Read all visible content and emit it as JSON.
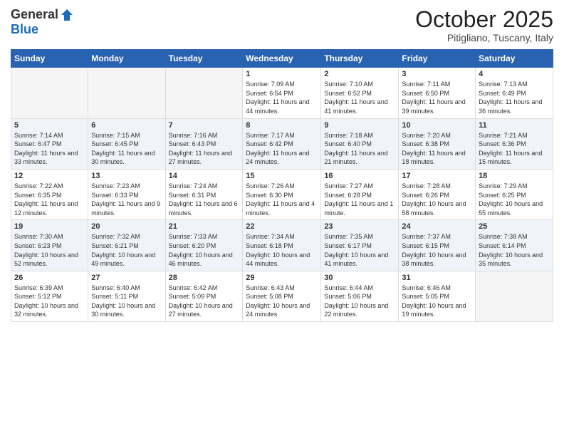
{
  "logo": {
    "general": "General",
    "blue": "Blue"
  },
  "title": "October 2025",
  "location": "Pitigliano, Tuscany, Italy",
  "days_of_week": [
    "Sunday",
    "Monday",
    "Tuesday",
    "Wednesday",
    "Thursday",
    "Friday",
    "Saturday"
  ],
  "weeks": [
    [
      {
        "day": "",
        "info": ""
      },
      {
        "day": "",
        "info": ""
      },
      {
        "day": "",
        "info": ""
      },
      {
        "day": "1",
        "info": "Sunrise: 7:09 AM\nSunset: 6:54 PM\nDaylight: 11 hours and 44 minutes."
      },
      {
        "day": "2",
        "info": "Sunrise: 7:10 AM\nSunset: 6:52 PM\nDaylight: 11 hours and 41 minutes."
      },
      {
        "day": "3",
        "info": "Sunrise: 7:11 AM\nSunset: 6:50 PM\nDaylight: 11 hours and 39 minutes."
      },
      {
        "day": "4",
        "info": "Sunrise: 7:13 AM\nSunset: 6:49 PM\nDaylight: 11 hours and 36 minutes."
      }
    ],
    [
      {
        "day": "5",
        "info": "Sunrise: 7:14 AM\nSunset: 6:47 PM\nDaylight: 11 hours and 33 minutes."
      },
      {
        "day": "6",
        "info": "Sunrise: 7:15 AM\nSunset: 6:45 PM\nDaylight: 11 hours and 30 minutes."
      },
      {
        "day": "7",
        "info": "Sunrise: 7:16 AM\nSunset: 6:43 PM\nDaylight: 11 hours and 27 minutes."
      },
      {
        "day": "8",
        "info": "Sunrise: 7:17 AM\nSunset: 6:42 PM\nDaylight: 11 hours and 24 minutes."
      },
      {
        "day": "9",
        "info": "Sunrise: 7:18 AM\nSunset: 6:40 PM\nDaylight: 11 hours and 21 minutes."
      },
      {
        "day": "10",
        "info": "Sunrise: 7:20 AM\nSunset: 6:38 PM\nDaylight: 11 hours and 18 minutes."
      },
      {
        "day": "11",
        "info": "Sunrise: 7:21 AM\nSunset: 6:36 PM\nDaylight: 11 hours and 15 minutes."
      }
    ],
    [
      {
        "day": "12",
        "info": "Sunrise: 7:22 AM\nSunset: 6:35 PM\nDaylight: 11 hours and 12 minutes."
      },
      {
        "day": "13",
        "info": "Sunrise: 7:23 AM\nSunset: 6:33 PM\nDaylight: 11 hours and 9 minutes."
      },
      {
        "day": "14",
        "info": "Sunrise: 7:24 AM\nSunset: 6:31 PM\nDaylight: 11 hours and 6 minutes."
      },
      {
        "day": "15",
        "info": "Sunrise: 7:26 AM\nSunset: 6:30 PM\nDaylight: 11 hours and 4 minutes."
      },
      {
        "day": "16",
        "info": "Sunrise: 7:27 AM\nSunset: 6:28 PM\nDaylight: 11 hours and 1 minute."
      },
      {
        "day": "17",
        "info": "Sunrise: 7:28 AM\nSunset: 6:26 PM\nDaylight: 10 hours and 58 minutes."
      },
      {
        "day": "18",
        "info": "Sunrise: 7:29 AM\nSunset: 6:25 PM\nDaylight: 10 hours and 55 minutes."
      }
    ],
    [
      {
        "day": "19",
        "info": "Sunrise: 7:30 AM\nSunset: 6:23 PM\nDaylight: 10 hours and 52 minutes."
      },
      {
        "day": "20",
        "info": "Sunrise: 7:32 AM\nSunset: 6:21 PM\nDaylight: 10 hours and 49 minutes."
      },
      {
        "day": "21",
        "info": "Sunrise: 7:33 AM\nSunset: 6:20 PM\nDaylight: 10 hours and 46 minutes."
      },
      {
        "day": "22",
        "info": "Sunrise: 7:34 AM\nSunset: 6:18 PM\nDaylight: 10 hours and 44 minutes."
      },
      {
        "day": "23",
        "info": "Sunrise: 7:35 AM\nSunset: 6:17 PM\nDaylight: 10 hours and 41 minutes."
      },
      {
        "day": "24",
        "info": "Sunrise: 7:37 AM\nSunset: 6:15 PM\nDaylight: 10 hours and 38 minutes."
      },
      {
        "day": "25",
        "info": "Sunrise: 7:38 AM\nSunset: 6:14 PM\nDaylight: 10 hours and 35 minutes."
      }
    ],
    [
      {
        "day": "26",
        "info": "Sunrise: 6:39 AM\nSunset: 5:12 PM\nDaylight: 10 hours and 32 minutes."
      },
      {
        "day": "27",
        "info": "Sunrise: 6:40 AM\nSunset: 5:11 PM\nDaylight: 10 hours and 30 minutes."
      },
      {
        "day": "28",
        "info": "Sunrise: 6:42 AM\nSunset: 5:09 PM\nDaylight: 10 hours and 27 minutes."
      },
      {
        "day": "29",
        "info": "Sunrise: 6:43 AM\nSunset: 5:08 PM\nDaylight: 10 hours and 24 minutes."
      },
      {
        "day": "30",
        "info": "Sunrise: 6:44 AM\nSunset: 5:06 PM\nDaylight: 10 hours and 22 minutes."
      },
      {
        "day": "31",
        "info": "Sunrise: 6:46 AM\nSunset: 5:05 PM\nDaylight: 10 hours and 19 minutes."
      },
      {
        "day": "",
        "info": ""
      }
    ]
  ]
}
